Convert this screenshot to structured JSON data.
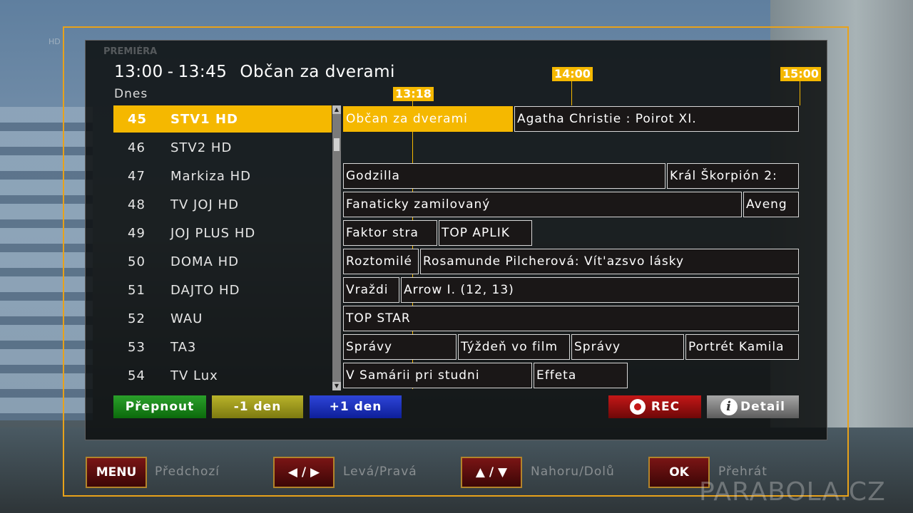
{
  "header": {
    "time_start": "13:00",
    "time_sep": "-",
    "time_end": "13:45",
    "title": "Občan za dverami",
    "day": "Dnes"
  },
  "ghost": {
    "top_left": "HD",
    "premiera": "PREMIÉRA"
  },
  "timeline": {
    "current": "13:18",
    "t1400": "14:00",
    "t1500": "15:00"
  },
  "channels": [
    {
      "num": "45",
      "name": "STV1 HD",
      "selected": true
    },
    {
      "num": "46",
      "name": "STV2 HD"
    },
    {
      "num": "47",
      "name": "Markiza HD"
    },
    {
      "num": "48",
      "name": "TV JOJ HD"
    },
    {
      "num": "49",
      "name": "JOJ PLUS HD"
    },
    {
      "num": "50",
      "name": "DOMA HD"
    },
    {
      "num": "51",
      "name": "DAJTO HD"
    },
    {
      "num": "52",
      "name": "WAU"
    },
    {
      "num": "53",
      "name": "TA3"
    },
    {
      "num": "54",
      "name": "TV Lux"
    }
  ],
  "programs": {
    "r0": [
      "Občan za dverami",
      "Agatha Christie : Poirot  XI."
    ],
    "r2": [
      "Godzilla",
      "Král Škorpión 2:"
    ],
    "r3": [
      "Fanaticky zamilovaný",
      "Aveng"
    ],
    "r4": [
      "Faktor stra",
      "TOP APLIK"
    ],
    "r5": [
      "Roztomilé",
      "Rosamunde Pilcherová: Vít'azsvo lásky"
    ],
    "r6": [
      "Vraždi",
      "Arrow I. (12, 13)"
    ],
    "r7": [
      "TOP STAR"
    ],
    "r8": [
      "Správy",
      "Týždeň vo film",
      "Správy",
      "Portrét Kamila"
    ],
    "r9": [
      "V Samárii pri studni",
      "Effeta"
    ]
  },
  "buttons": {
    "green": "Přepnout",
    "yellow": "-1 den",
    "blue": "+1 den",
    "rec": "REC",
    "detail": "Detail"
  },
  "nav": {
    "menu": "MENU",
    "menu_label": "Předchozí",
    "lr": "◀ / ▶",
    "lr_label": "Levá/Pravá",
    "ud": "▲ / ▼",
    "ud_label": "Nahoru/Dolů",
    "ok": "OK",
    "ok_label": "Přehrát"
  },
  "watermark": "PARABOLA.CZ",
  "colors": {
    "accent": "#f5b800",
    "rec": "#c41717",
    "green": "#1e8a1e",
    "yellow": "#a09a1e",
    "blue": "#1a2fc0"
  }
}
